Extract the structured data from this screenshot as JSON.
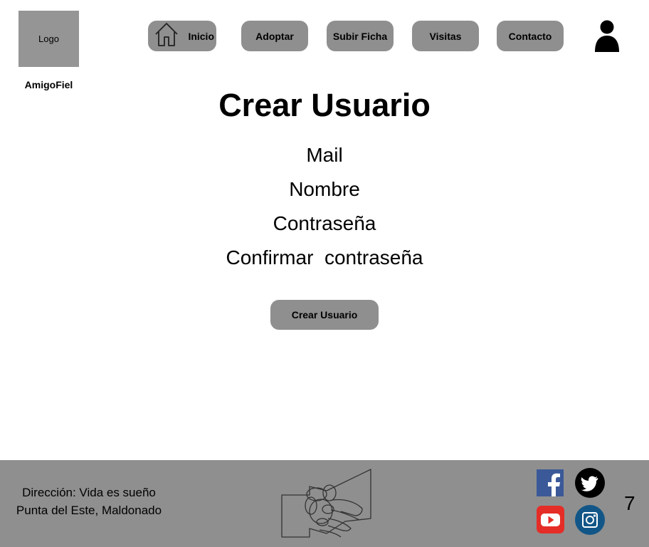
{
  "header": {
    "logo_label": "Logo",
    "brand_name": "AmigoFiel",
    "nav": [
      {
        "label": "Inicio",
        "icon": "home-icon"
      },
      {
        "label": "Adoptar"
      },
      {
        "label": "Subir Ficha"
      },
      {
        "label": "Visitas"
      },
      {
        "label": "Contacto"
      }
    ],
    "user_icon": "user-icon"
  },
  "main": {
    "title": "Crear Usuario",
    "fields": [
      "Mail",
      "Nombre",
      "Contraseña",
      "Confirmar  contraseña"
    ],
    "submit_label": "Crear Usuario"
  },
  "footer": {
    "address_line1": "Dirección: Vida es sueño",
    "address_line2": "Punta del Este, Maldonado",
    "center_icon": "handshake-icon",
    "social": [
      "facebook-icon",
      "twitter-icon",
      "youtube-icon",
      "instagram-icon"
    ],
    "page_number": "7"
  },
  "colors": {
    "gray": "#8f8f8f",
    "logo_gray": "#959595",
    "facebook": "#3b5998",
    "youtube": "#e52d27",
    "instagram": "#125688"
  }
}
